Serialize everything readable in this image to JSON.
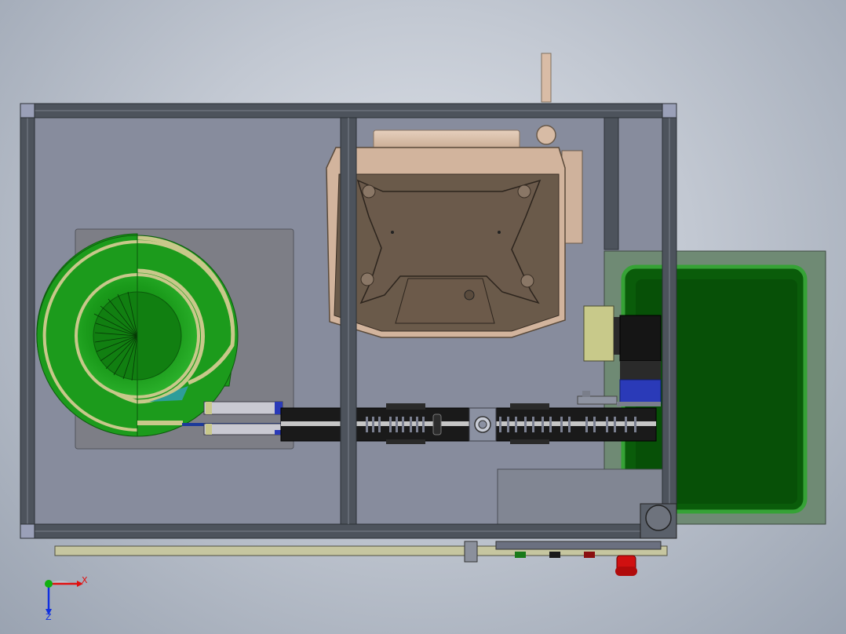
{
  "viewport": {
    "background_top": "#dfe3ea",
    "background_bottom": "#9aa3b1"
  },
  "triad": {
    "x_label": "X",
    "z_label": "Z",
    "x_color": "#e01010",
    "y_color": "#10b010",
    "z_color": "#1030e0"
  },
  "colors": {
    "frame": "#4d535c",
    "panel": "#868c9d",
    "bowl_green": "#1a9a1a",
    "bowl_light": "#3ec63e",
    "track_tan": "#c8c88a",
    "motor_body": "#6a5a4a",
    "motor_tan": "#d7bba5",
    "conveyor": "#1a1a1a",
    "tray_green": "#0a5c0a",
    "tray_border": "#35a035",
    "estop_red": "#d01010",
    "stepper_blue": "#2a3ab8"
  },
  "icons": [
    "feeder-bowl-icon",
    "motor-icon",
    "conveyor-icon",
    "estop-icon",
    "axis-triad-icon"
  ]
}
